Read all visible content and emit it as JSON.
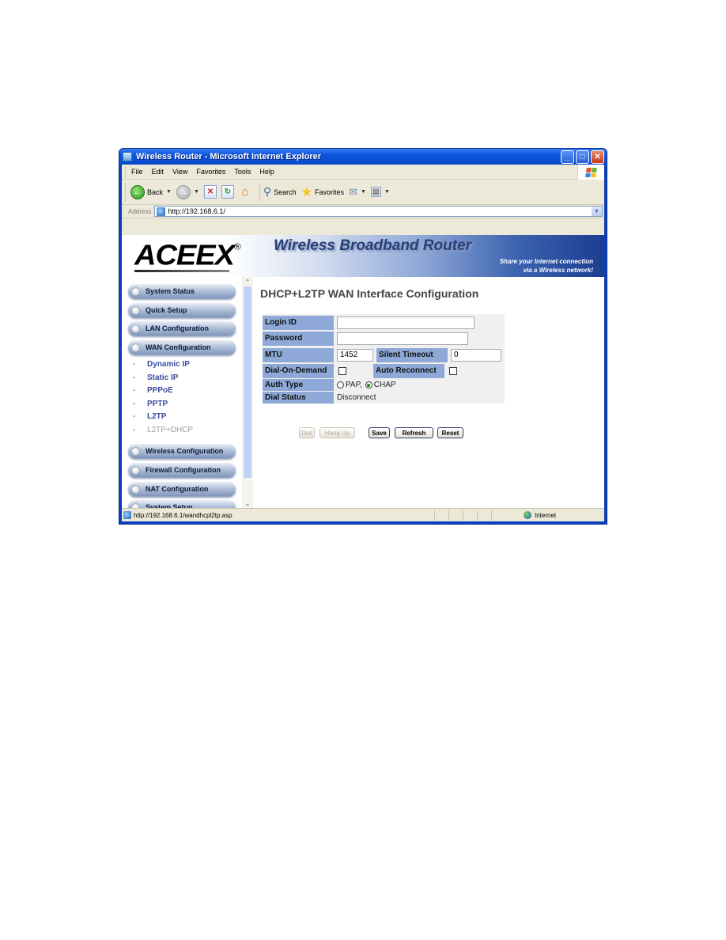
{
  "window": {
    "title": "Wireless Router - Microsoft Internet Explorer",
    "minimize": "_",
    "maximize": "□",
    "close": "✕"
  },
  "menu": [
    "File",
    "Edit",
    "View",
    "Favorites",
    "Tools",
    "Help"
  ],
  "toolbar": {
    "back_label": "Back",
    "search_label": "Search",
    "favorites_label": "Favorites"
  },
  "address": {
    "label": "Address",
    "url": "http://192.168.6.1/"
  },
  "banner": {
    "logo": "ACEEX",
    "logo_mark": "®",
    "title": "Wireless Broadband Router",
    "tagline_line1": "Share your Internet connection",
    "tagline_line2": "via a Wireless network!"
  },
  "sidebar": {
    "main_items": [
      {
        "label": "System Status"
      },
      {
        "label": "Quick Setup"
      },
      {
        "label": "LAN Configuration"
      },
      {
        "label": "WAN Configuration"
      }
    ],
    "sub_items": [
      {
        "label": "Dynamic IP"
      },
      {
        "label": "Static IP"
      },
      {
        "label": "PPPoE"
      },
      {
        "label": "PPTP"
      },
      {
        "label": "L2TP"
      },
      {
        "label": "L2TP+DHCP",
        "active": true
      }
    ],
    "more_items": [
      {
        "label": "Wireless Configuration"
      },
      {
        "label": "Firewall Configuration"
      },
      {
        "label": "NAT Configuration"
      },
      {
        "label": "System Setup"
      }
    ],
    "dash": "-"
  },
  "page": {
    "title": "DHCP+L2TP WAN Interface Configuration",
    "fields": {
      "login_id": {
        "label": "Login ID",
        "value": ""
      },
      "password": {
        "label": "Password",
        "value": ""
      },
      "mtu": {
        "label": "MTU",
        "value": "1452"
      },
      "silent_timeout": {
        "label": "Silent Timeout",
        "value": "0"
      },
      "dial_on_demand": {
        "label": "Dial-On-Demand",
        "checked": false
      },
      "auto_reconnect": {
        "label": "Auto Reconnect",
        "checked": false
      },
      "auth_type": {
        "label": "Auth Type",
        "options": [
          "PAP,",
          "CHAP"
        ],
        "selected": "CHAP"
      },
      "dial_status": {
        "label": "Dial Status",
        "value": "Disconnect"
      }
    },
    "buttons": {
      "dial": "Dial",
      "hang_up": "Hang Up",
      "save": "Save",
      "refresh": "Refresh",
      "reset": "Reset"
    }
  },
  "statusbar": {
    "url": "http://192.168.6.1/wandhcpl2tp.asp",
    "zone": "Internet"
  }
}
